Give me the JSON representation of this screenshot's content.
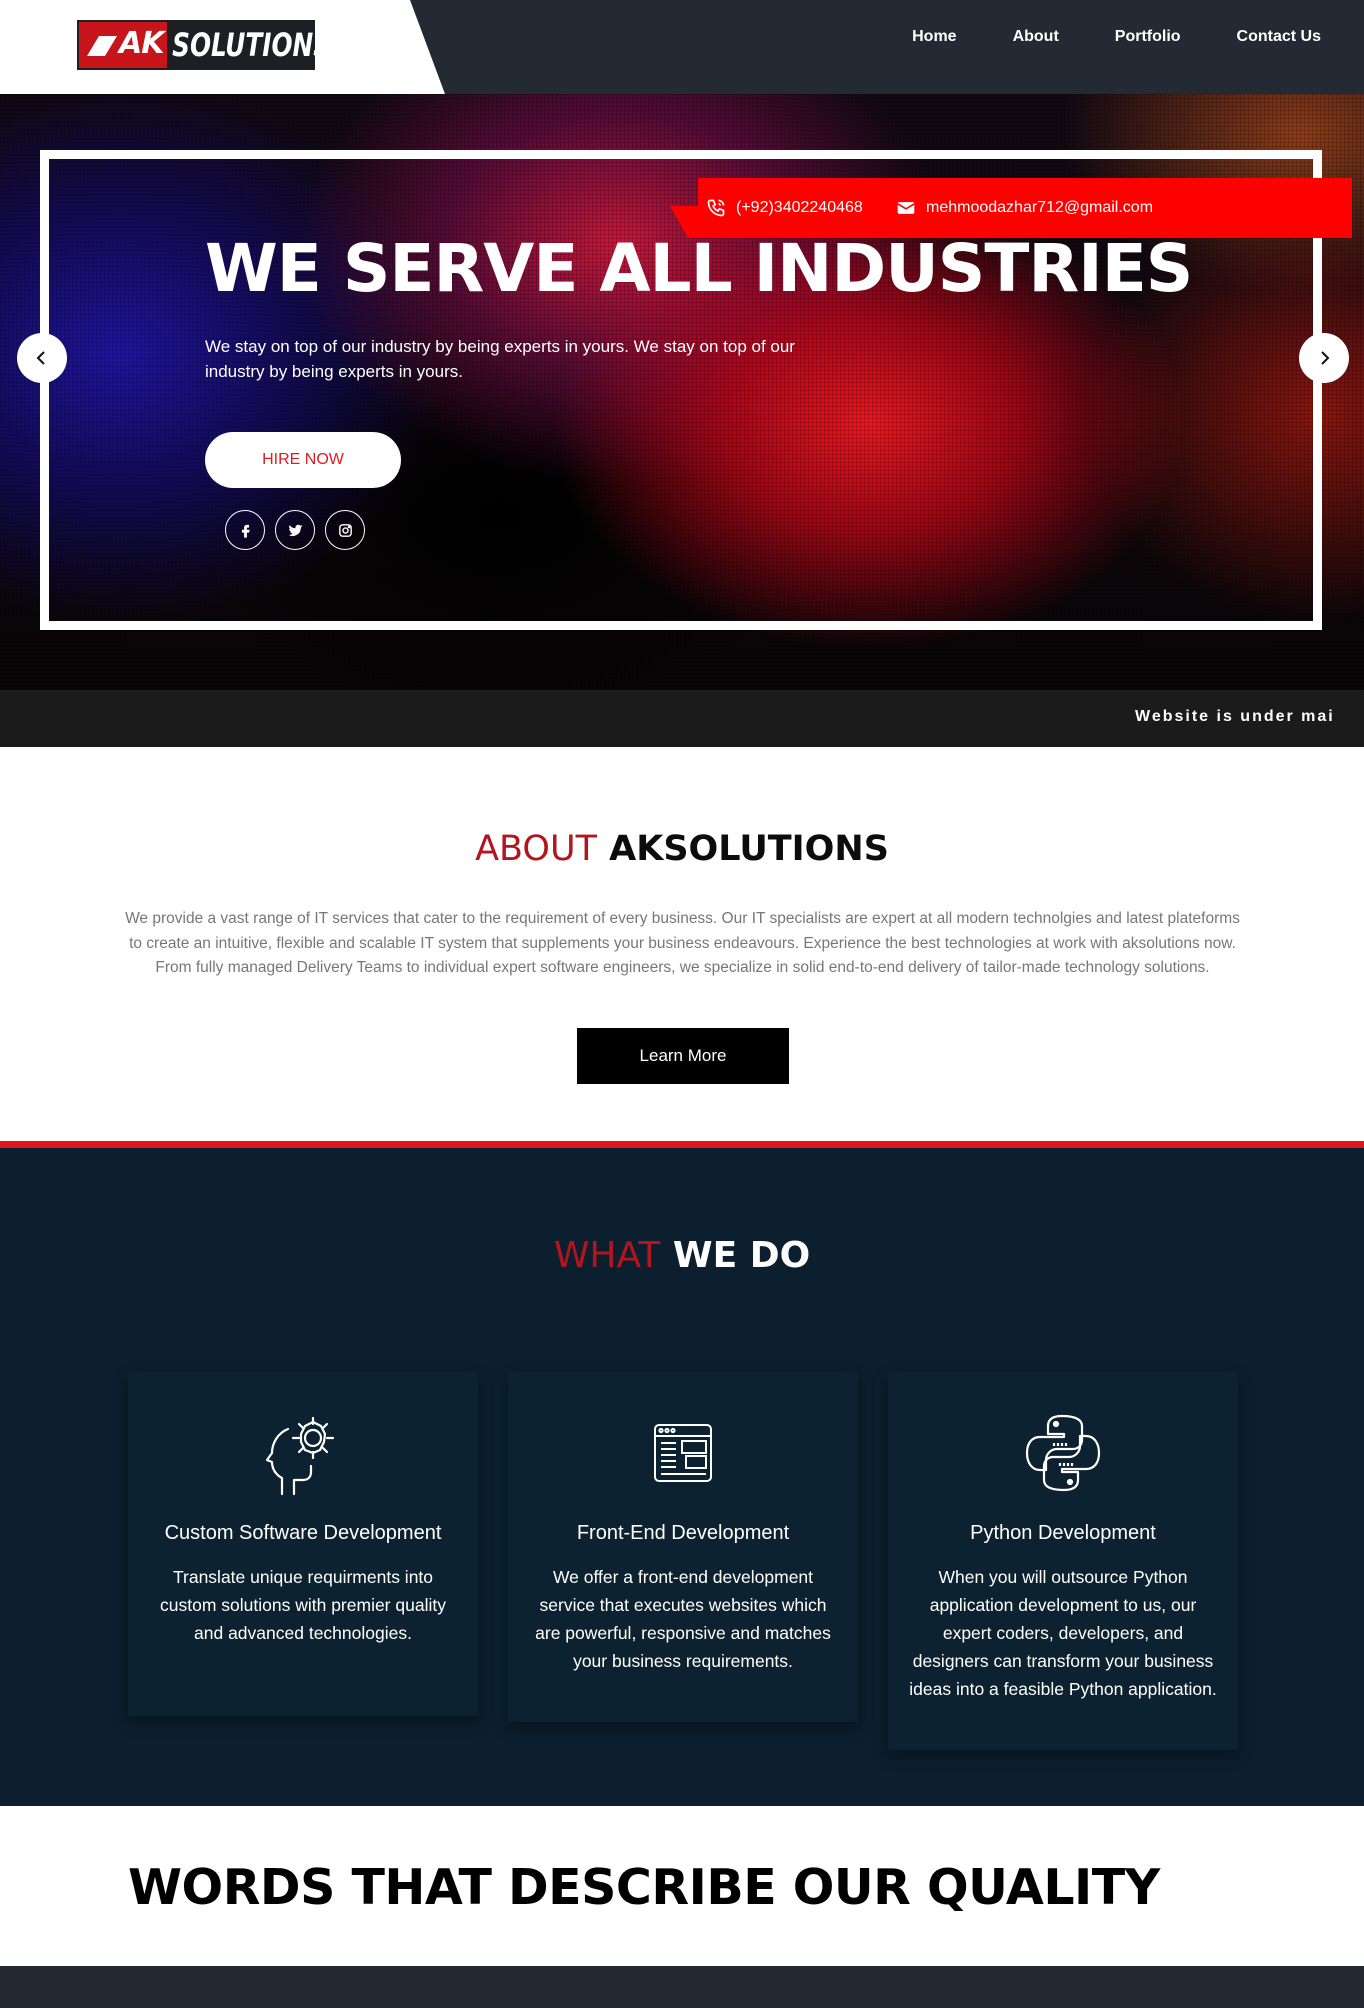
{
  "brand": {
    "mark": "AK",
    "word": "SOLUTIONS"
  },
  "nav": {
    "items": [
      "Home",
      "About",
      "Portfolio",
      "Contact Us"
    ]
  },
  "contact": {
    "phone": "(+92)3402240468",
    "email": "mehmoodazhar712@gmail.com"
  },
  "hero": {
    "title": "WE SERVE ALL INDUSTRIES",
    "text": "We stay on top of our industry by being experts in yours. We stay on top of our industry by being experts in yours.",
    "cta": "HIRE NOW",
    "socials": [
      "facebook-icon",
      "twitter-icon",
      "instagram-icon"
    ]
  },
  "marquee": {
    "text": "Website is under mai"
  },
  "about": {
    "title_red": "ABOUT",
    "title_dark": "AKSOLUTIONS",
    "text": "We provide a vast range of IT services that cater to the requirement of every business. Our IT specialists are expert at all modern technolgies and latest plateforms to create an intuitive, flexible and scalable IT system that supplements your business endeavours. Experience the best technologies at work with aksolutions now. From fully managed Delivery Teams to individual expert software engineers, we specialize in solid end-to-end delivery of tailor-made technology solutions.",
    "button": "Learn More"
  },
  "services": {
    "title_red": "WHAT",
    "title_white": "WE DO",
    "cards": [
      {
        "icon": "head-gear-icon",
        "title": "Custom Software Development",
        "text": "Translate unique requirments into custom solutions with premier quality and advanced technologies."
      },
      {
        "icon": "browser-layout-icon",
        "title": "Front-End Development",
        "text": "We offer a front-end development service that executes websites which are powerful, responsive and matches your business requirements."
      },
      {
        "icon": "python-icon",
        "title": "Python Development",
        "text": "When you will outsource Python application development to us, our expert coders, developers, and designers can transform your business ideas into a feasible Python application."
      }
    ]
  },
  "words": {
    "title": "WORDS THAT DESCRIBE OUR QUALITY"
  },
  "colors": {
    "accent": "#ff0000",
    "brand_red": "#b3151f",
    "navy": "#0b1f2e",
    "header": "#232a33"
  }
}
